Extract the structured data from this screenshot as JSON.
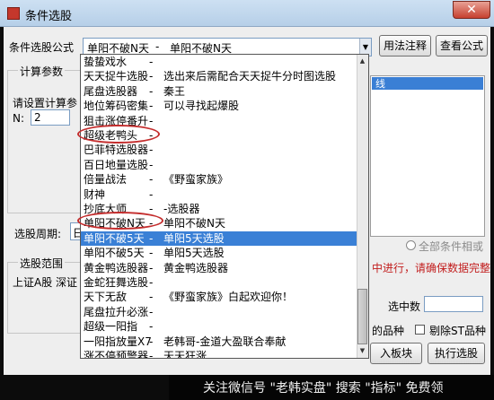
{
  "window": {
    "title": "条件选股",
    "close": "✕"
  },
  "formula": {
    "label": "条件选股公式",
    "value_name": "单阳不破N天",
    "value_sep": "-",
    "value_desc": "单阳不破N天"
  },
  "buttons": {
    "usage": "用法注释",
    "view": "查看公式",
    "add_block": "入板块",
    "execute": "执行选股"
  },
  "params": {
    "group": "计算参数",
    "hint": "请设置计算参",
    "n_label": "N:",
    "n_value": "2"
  },
  "period": {
    "label": "选股周期:",
    "value": "日"
  },
  "scope": {
    "group": "选股范围",
    "value": "上证A股 深证"
  },
  "right_list": {
    "selected_fragment": "线"
  },
  "options": {
    "all_conditions": "全部条件相或",
    "warning": "中进行，请确保数据完整",
    "selected_count": "选中数",
    "variety_fragment": "的品种",
    "remove_st": "剔除ST品种"
  },
  "dropdown_items": [
    {
      "name": "蛰蛰戏水",
      "sep": "-",
      "desc": ""
    },
    {
      "name": "天天捉牛选股",
      "sep": "-",
      "desc": "选出来后需配合天天捉牛分时图选股"
    },
    {
      "name": "尾盘选股器",
      "sep": "-",
      "desc": "秦王"
    },
    {
      "name": "地位筹码密集",
      "sep": "-",
      "desc": "可以寻找起爆股"
    },
    {
      "name": "狙击涨停番升",
      "sep": "-",
      "desc": ""
    },
    {
      "name": "超级老鸭头",
      "sep": "-",
      "desc": ""
    },
    {
      "name": "巴菲特选股器",
      "sep": "-",
      "desc": ""
    },
    {
      "name": "百日地量选股",
      "sep": "-",
      "desc": ""
    },
    {
      "name": "倍量战法",
      "sep": "-",
      "desc": "《野蛮家族》"
    },
    {
      "name": "财神",
      "sep": "-",
      "desc": ""
    },
    {
      "name": "抄底大师",
      "sep": "-",
      "desc": "-选股器"
    },
    {
      "name": "单阳不破N天",
      "sep": "-",
      "desc": "单阳不破N天"
    },
    {
      "name": "单阳不破5天",
      "sep": "-",
      "desc": "单阳5天选股"
    },
    {
      "name": "单阳不破5天",
      "sep": "-",
      "desc": "单阳5天选股"
    },
    {
      "name": "黄金鸭选股器",
      "sep": "-",
      "desc": "黄金鸭选股器"
    },
    {
      "name": "金蛇狂舞选股",
      "sep": "-",
      "desc": ""
    },
    {
      "name": "天下无敌",
      "sep": "-",
      "desc": "《野蛮家族》白起欢迎你！"
    },
    {
      "name": "尾盘拉升必涨",
      "sep": "-",
      "desc": ""
    },
    {
      "name": "超级一阳指",
      "sep": "-",
      "desc": ""
    },
    {
      "name": "一阳指放量X7",
      "sep": "-",
      "desc": "老韩哥-金道大盈联合奉献"
    },
    {
      "name": "涨不停预警器",
      "sep": "-",
      "desc": "天天狂涨"
    }
  ],
  "watermark": "关注微信号 \"老韩实盘\" 搜索 \"指标\" 免费领"
}
